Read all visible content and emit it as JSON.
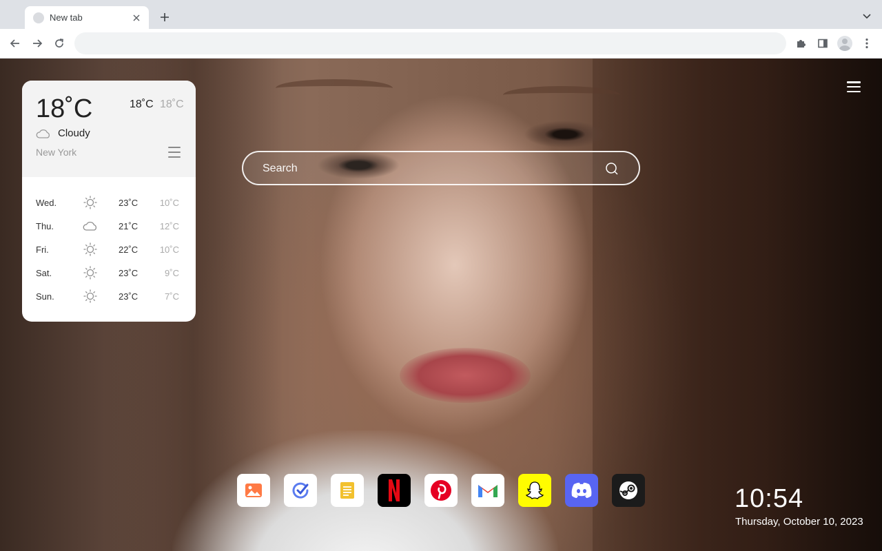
{
  "browser": {
    "tab_title": "New tab",
    "omnibox_value": ""
  },
  "weather": {
    "current_temp": "18˚C",
    "high": "18˚C",
    "low": "18˚C",
    "condition": "Cloudy",
    "city": "New York",
    "forecast": [
      {
        "day": "Wed.",
        "icon": "sun-icon",
        "high": "23˚C",
        "low": "10˚C"
      },
      {
        "day": "Thu.",
        "icon": "cloud-icon",
        "high": "21˚C",
        "low": "12˚C"
      },
      {
        "day": "Fri.",
        "icon": "sun-icon",
        "high": "22˚C",
        "low": "10˚C"
      },
      {
        "day": "Sat.",
        "icon": "sun-icon",
        "high": "23˚C",
        "low": "9˚C"
      },
      {
        "day": "Sun.",
        "icon": "sun-icon",
        "high": "23˚C",
        "low": "7˚C"
      }
    ]
  },
  "search": {
    "placeholder": "Search"
  },
  "dock": [
    {
      "name": "photos-app",
      "icon": "image-icon",
      "color": "#ff7a45"
    },
    {
      "name": "tasks-app",
      "icon": "check-circle-icon",
      "color": "#5b7cf0"
    },
    {
      "name": "notes-app",
      "icon": "notes-icon",
      "color": "#f2c12e"
    },
    {
      "name": "netflix-app",
      "icon": "netflix-icon",
      "color": "#e50914"
    },
    {
      "name": "pinterest-app",
      "icon": "pinterest-icon",
      "color": "#e60023"
    },
    {
      "name": "gmail-app",
      "icon": "gmail-icon",
      "color": "#ea4335"
    },
    {
      "name": "snapchat-app",
      "icon": "snapchat-icon",
      "color": "#fffc00"
    },
    {
      "name": "discord-app",
      "icon": "discord-icon",
      "color": "#5865f2"
    },
    {
      "name": "steam-app",
      "icon": "steam-icon",
      "color": "#1b1b1b"
    }
  ],
  "clock": {
    "time": "10:54",
    "date": "Thursday, October 10, 2023"
  }
}
